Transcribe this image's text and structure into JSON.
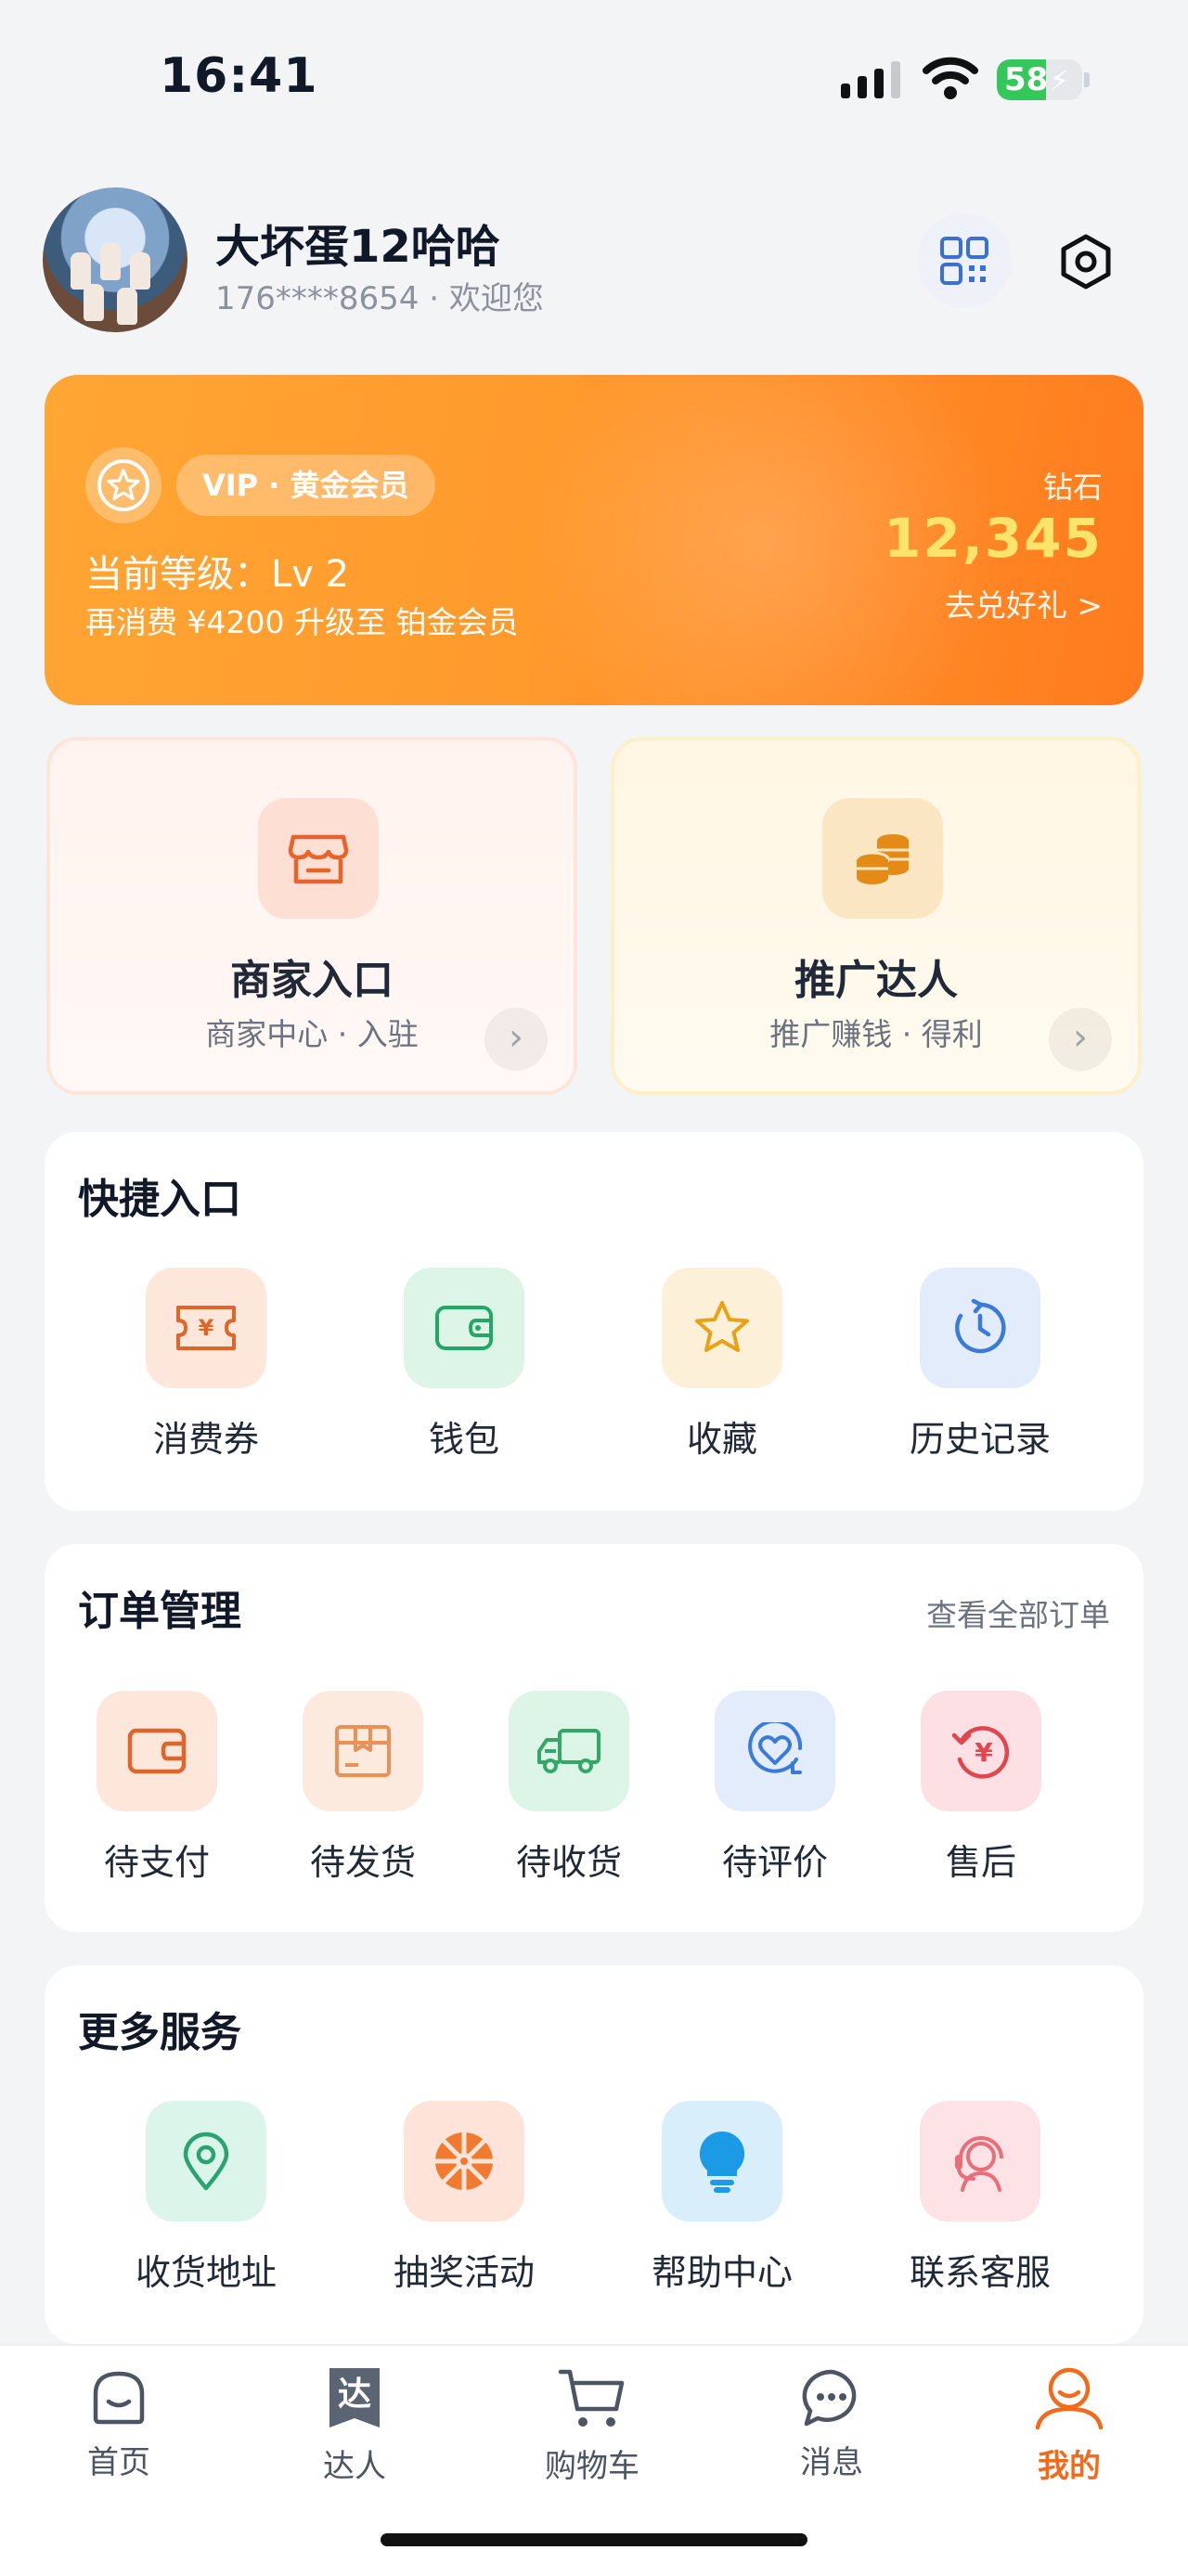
{
  "status_bar": {
    "time": "16:41",
    "battery": "58",
    "battery_level": 0.58
  },
  "profile": {
    "name": "大坏蛋12哈哈",
    "phone_greeting": "176****8654 · 欢迎您"
  },
  "membership": {
    "badge": "VIP · 黄金会员",
    "level": "当前等级：Lv 2",
    "upgrade_hint": "再消费 ¥4200 升级至 铂金会员",
    "diamond_label": "钻石",
    "diamond_value": "12,345",
    "redeem_link": "去兑好礼 >"
  },
  "entries": [
    {
      "title": "商家入口",
      "subtitle": "商家中心 · 入驻",
      "icon": "store-icon"
    },
    {
      "title": "推广达人",
      "subtitle": "推广赚钱 · 得利",
      "icon": "coins-icon"
    }
  ],
  "quick_access": {
    "title": "快捷入口",
    "items": [
      {
        "label": "消费券",
        "icon": "coupon-icon"
      },
      {
        "label": "钱包",
        "icon": "wallet-icon"
      },
      {
        "label": "收藏",
        "icon": "star-icon"
      },
      {
        "label": "历史记录",
        "icon": "history-icon"
      }
    ]
  },
  "orders": {
    "title": "订单管理",
    "view_all": "查看全部订单",
    "items": [
      {
        "label": "待支付",
        "icon": "wallet-pay-icon"
      },
      {
        "label": "待发货",
        "icon": "package-icon"
      },
      {
        "label": "待收货",
        "icon": "truck-icon"
      },
      {
        "label": "待评价",
        "icon": "heart-comment-icon"
      },
      {
        "label": "售后",
        "icon": "refund-icon"
      }
    ]
  },
  "services": {
    "title": "更多服务",
    "items": [
      {
        "label": "收货地址",
        "icon": "location-icon"
      },
      {
        "label": "抽奖活动",
        "icon": "lottery-wheel-icon"
      },
      {
        "label": "帮助中心",
        "icon": "lightbulb-icon"
      },
      {
        "label": "联系客服",
        "icon": "headset-icon"
      }
    ]
  },
  "tabbar": {
    "tabs": [
      {
        "label": "首页",
        "icon": "home-face-icon"
      },
      {
        "label": "达人",
        "icon": "talent-icon",
        "glyph": "达"
      },
      {
        "label": "购物车",
        "icon": "cart-icon"
      },
      {
        "label": "消息",
        "icon": "message-icon"
      },
      {
        "label": "我的",
        "icon": "profile-icon",
        "active": true
      }
    ]
  },
  "colors": {
    "accent": "#f26a1b",
    "vip_gold": "#ffe46b"
  }
}
